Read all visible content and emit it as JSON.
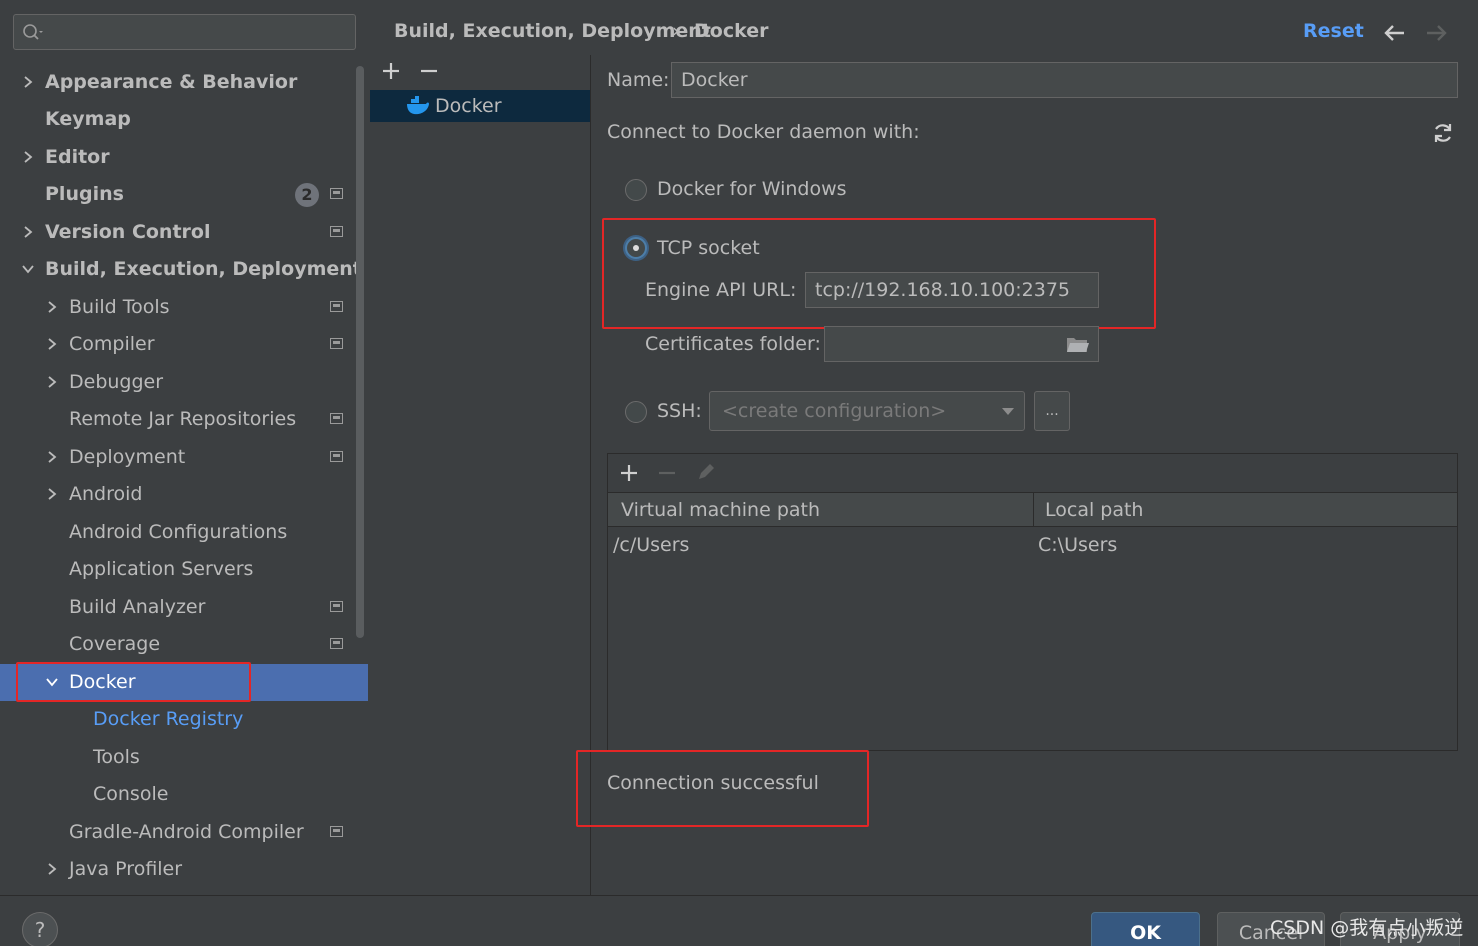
{
  "sidebar": {
    "search_placeholder": "",
    "items": [
      {
        "label": "Appearance & Behavior",
        "bold": true,
        "arrow": "right"
      },
      {
        "label": "Keymap",
        "bold": true
      },
      {
        "label": "Editor",
        "bold": true,
        "arrow": "right"
      },
      {
        "label": "Plugins",
        "bold": true,
        "badge": "2"
      },
      {
        "label": "Version Control",
        "bold": true,
        "arrow": "right"
      },
      {
        "label": "Build, Execution, Deployment",
        "bold": true,
        "arrow": "down"
      },
      {
        "label": "Build Tools",
        "arrow": "right"
      },
      {
        "label": "Compiler",
        "arrow": "right"
      },
      {
        "label": "Debugger",
        "arrow": "right"
      },
      {
        "label": "Remote Jar Repositories"
      },
      {
        "label": "Deployment",
        "arrow": "right"
      },
      {
        "label": "Android",
        "arrow": "right"
      },
      {
        "label": "Android Configurations"
      },
      {
        "label": "Application Servers"
      },
      {
        "label": "Build Analyzer"
      },
      {
        "label": "Coverage"
      },
      {
        "label": "Docker",
        "arrow": "down",
        "selected": true
      },
      {
        "label": "Docker Registry",
        "link": true
      },
      {
        "label": "Tools"
      },
      {
        "label": "Console"
      },
      {
        "label": "Gradle-Android Compiler"
      },
      {
        "label": "Java Profiler",
        "arrow": "right"
      }
    ]
  },
  "header": {
    "breadcrumb": [
      "Build, Execution, Deployment",
      "Docker"
    ],
    "separator": "›",
    "reset_label": "Reset"
  },
  "config_list": {
    "items": [
      "Docker"
    ]
  },
  "form": {
    "name_label": "Name:",
    "name_value": "Docker",
    "connect_label": "Connect to Docker daemon with:",
    "option_windows": "Docker for Windows",
    "option_tcp": "TCP socket",
    "engine_api_label": "Engine API URL:",
    "engine_api_value": "tcp://192.168.10.100:2375",
    "cert_label": "Certificates folder:",
    "cert_value": "",
    "option_ssh": "SSH:",
    "ssh_placeholder": "<create configuration>",
    "ssh_more": "...",
    "selected_option": "TCP socket"
  },
  "mappings": {
    "columns": [
      "Virtual machine path",
      "Local path"
    ],
    "rows": [
      [
        "/c/Users",
        "C:\\Users"
      ]
    ]
  },
  "status": {
    "message": "Connection successful"
  },
  "footer": {
    "help": "?",
    "ok": "OK",
    "cancel": "Cancel",
    "apply": "Apply",
    "watermark": "CSDN @我有点小叛逆"
  },
  "colors": {
    "background": "#3c3f41",
    "selection": "#4b6eaf",
    "link": "#589df6",
    "highlight_box": "#e32626",
    "ok_button": "#365880"
  }
}
